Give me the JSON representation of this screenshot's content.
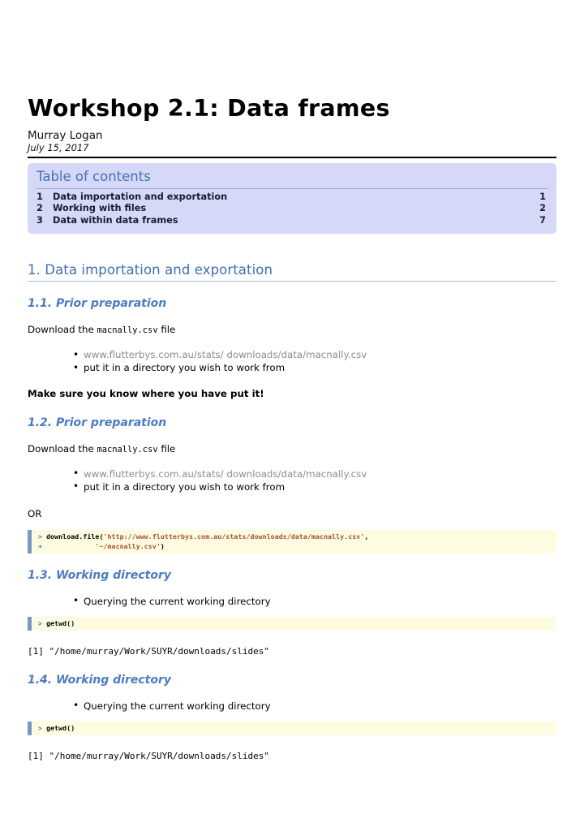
{
  "document": {
    "title": "Workshop 2.1: Data frames",
    "author": "Murray Logan",
    "date": "July 15, 2017"
  },
  "toc": {
    "heading": "Table of contents",
    "entries": [
      {
        "num": "1",
        "label": "Data importation and exportation",
        "page": "1"
      },
      {
        "num": "2",
        "label": "Working with files",
        "page": "2"
      },
      {
        "num": "3",
        "label": "Data within data frames",
        "page": "7"
      }
    ]
  },
  "sections": {
    "s1": {
      "heading": "1. Data importation and exportation"
    },
    "s1_1": {
      "heading": "1.1. Prior preparation",
      "intro_before": "Download the ",
      "intro_code": "macnally.csv",
      "intro_after": " file",
      "bullets": [
        "www.flutterbys.com.au/stats/ downloads/data/macnally.csv",
        "put it in a directory you wish to work from"
      ],
      "note": "Make sure you know where you have put it!"
    },
    "s1_2": {
      "heading": "1.2. Prior preparation",
      "intro_before": "Download the ",
      "intro_code": "macnally.csv",
      "intro_after": " file",
      "bullets": [
        "www.flutterbys.com.au/stats/ downloads/data/macnally.csv",
        "put it in a directory you wish to work from"
      ],
      "or_label": "OR",
      "code": {
        "prompt1": "> ",
        "fn": "download.file(",
        "str1": "'http://www.flutterbys.com.au/stats/downloads/data/macnally.csv'",
        "comma": ",",
        "prompt2": "+ ",
        "indent": "            ",
        "str2": "'~/macnally.csv'",
        "close": ")"
      }
    },
    "s1_3": {
      "heading": "1.3. Working directory",
      "bullets": [
        "Querying the current working directory"
      ],
      "code": {
        "prompt": "> ",
        "fn": "getwd()"
      },
      "output": "[1] \"/home/murray/Work/SUYR/downloads/slides\""
    },
    "s1_4": {
      "heading": "1.4. Working directory",
      "bullets": [
        "Querying the current working directory"
      ],
      "code": {
        "prompt": "> ",
        "fn": "getwd()"
      },
      "output": "[1] \"/home/murray/Work/SUYR/downloads/slides\""
    }
  },
  "colors": {
    "toc_background": "#d5d9f7",
    "heading_blue": "#3f6fb0",
    "code_background": "#fdfce1",
    "code_border": "#7b96c4",
    "string_literal": "#a0522d",
    "prompt_blue": "#4b78c8",
    "url_grey": "#8c8c8c"
  }
}
